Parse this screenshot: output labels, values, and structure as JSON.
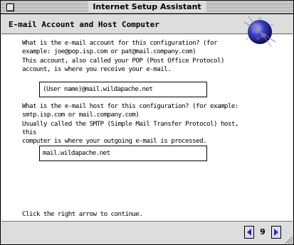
{
  "window": {
    "title": "Internet Setup Assistant"
  },
  "header": {
    "title": "E-mail Account and Host Computer"
  },
  "content": {
    "account_question": "What is the e-mail account for this configuration? (for\nexample: joe@pop.isp.com or pat@mail.company.com)\nThis account, also called your POP (Post Office Protocol)\naccount, is where you receive your e-mail.",
    "account_value": "(User name)@mail.wildapache.net",
    "host_question": "What is the e-mail host for this configuration? (for example:\nsmtp.isp.com or mail.company.com)\nUsually called the SMTP (Simple Mail Transfer Protocol) host, this\ncomputer is where your outgoing e-mail is processed.",
    "host_value": "mail.wildapache.net",
    "footer": "Click the right arrow to continue."
  },
  "nav": {
    "page": "9"
  },
  "icons": {
    "close": "close-box-icon",
    "globe": "globe-icon",
    "prev": "left-arrow-icon",
    "next": "right-arrow-icon",
    "grow": "grow-box-icon"
  }
}
